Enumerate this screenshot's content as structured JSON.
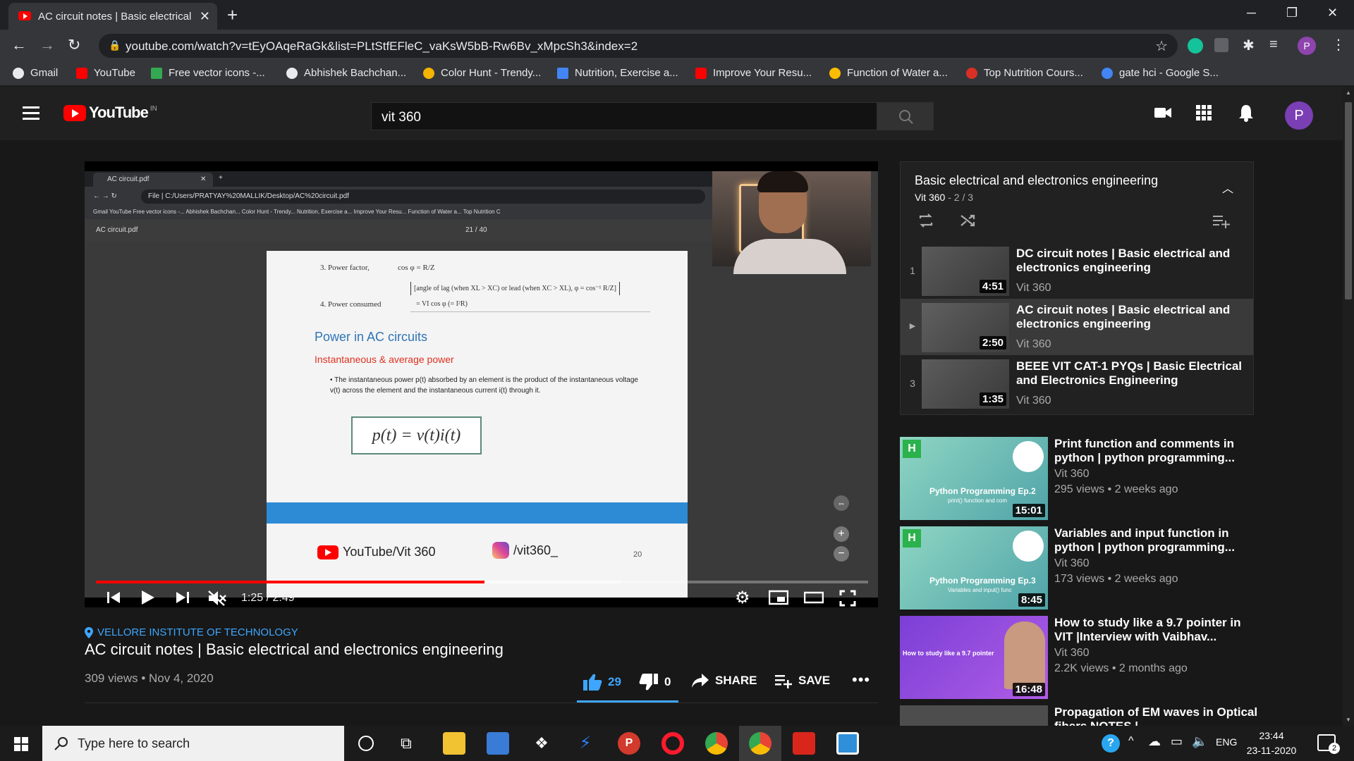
{
  "browser": {
    "tab_title": "AC circuit notes | Basic electrical",
    "new_tab": "+",
    "url": "youtube.com/watch?v=tEyOAqeRaGk&list=PLtStfEFleC_vaKsW5bB-Rw6Bv_xMpcSh3&index=2",
    "profile_initial": "P",
    "bookmarks": [
      {
        "label": "Gmail",
        "color": "#e8eaed"
      },
      {
        "label": "YouTube",
        "color": "#ff0000"
      },
      {
        "label": "Free vector icons -...",
        "color": "#34a853"
      },
      {
        "label": "Abhishek Bachchan...",
        "color": "#e8eaed"
      },
      {
        "label": "Color Hunt - Trendy...",
        "color": "#f4b400"
      },
      {
        "label": "Nutrition, Exercise a...",
        "color": "#4285f4"
      },
      {
        "label": "Improve Your Resu...",
        "color": "#ff0000"
      },
      {
        "label": "Function of Water a...",
        "color": "#fbbc04"
      },
      {
        "label": "Top Nutrition Cours...",
        "color": "#d93025"
      },
      {
        "label": "gate hci - Google S...",
        "color": "#4285f4"
      }
    ]
  },
  "youtube": {
    "logo_text": "YouTube",
    "region": "IN",
    "search_query": "vit 360",
    "avatar_initial": "P"
  },
  "player": {
    "time": "1:25 / 2:49",
    "progress_fraction": 0.503,
    "buffered_fraction": 0.48,
    "screen": {
      "tab": "AC circuit.pdf",
      "path": "File | C:/Users/PRATYAY%20MALLIK/Desktop/AC%20circuit.pdf",
      "bookmarks": "Gmail   YouTube   Free vector icons -...   Abhishek Bachchan...   Color Hunt - Trendy...   Nutrition, Exercise a...   Improve Your Resu...   Function of Water a...   Top Nutrition C",
      "pdf_name": "AC circuit.pdf",
      "page_count": "21 / 40",
      "line1": "3. Power factor,",
      "line1_formula": "cos φ = R/Z",
      "line2": "[angle of lag (when XL > XC) or lead (when XC > XL), φ = cos⁻¹ R/Z]",
      "line3": "4. Power consumed",
      "line3_formula": "= VI cos φ (= I²R)",
      "heading": "Power in AC circuits",
      "subheading": "Instantaneous & average power",
      "bullet": "The instantaneous power p(t) absorbed by an element is the product of the instantaneous voltage v(t) across the element and the instantaneous current i(t) through it.",
      "formula": "p(t) = v(t)i(t)",
      "footer_youtube": "YouTube/Vit 360",
      "footer_insta": "/vit360_",
      "page_number": "20"
    }
  },
  "video": {
    "location": "VELLORE INSTITUTE OF TECHNOLOGY",
    "title": "AC circuit notes | Basic electrical and electronics engineering",
    "views_date": "309 views • Nov 4, 2020",
    "likes": "29",
    "dislikes": "0",
    "share": "SHARE",
    "save": "SAVE"
  },
  "playlist": {
    "title": "Basic electrical and electronics engineering",
    "channel": "Vit 360",
    "position": " - 2 / 3",
    "items": [
      {
        "index": "1",
        "title": "DC circuit notes | Basic electrical and electronics engineering",
        "channel": "Vit 360",
        "duration": "4:51"
      },
      {
        "index": "▶",
        "title": "AC circuit notes | Basic electrical and electronics engineering",
        "channel": "Vit 360",
        "duration": "2:50"
      },
      {
        "index": "3",
        "title": "BEEE VIT CAT-1 PYQs | Basic Electrical and Electronics Engineering",
        "channel": "Vit 360",
        "duration": "1:35"
      }
    ]
  },
  "recommendations": [
    {
      "title": "Print function and comments in python | python programming...",
      "channel": "Vit 360",
      "meta": "295 views • 2 weeks ago",
      "duration": "15:01",
      "thumb_text": "Python Programming Ep.2",
      "thumb_sub": "print() function and com"
    },
    {
      "title": "Variables and input function in python | python programming...",
      "channel": "Vit 360",
      "meta": "173 views • 2 weeks ago",
      "duration": "8:45",
      "thumb_text": "Python Programming Ep.3",
      "thumb_sub": "Variables and input() func"
    },
    {
      "title": "How to study like a 9.7 pointer in VIT |Interview with Vaibhav...",
      "channel": "Vit 360",
      "meta": "2.2K views • 2 months ago",
      "duration": "16:48",
      "thumb_text": "How to study like a 9.7 pointer",
      "thumb_sub": ""
    },
    {
      "title": "Propagation of EM waves in Optical fibers NOTES |",
      "channel": "",
      "meta": "",
      "duration": "",
      "thumb_text": "",
      "thumb_sub": ""
    }
  ],
  "taskbar": {
    "search_placeholder": "Type here to search",
    "lang": "ENG",
    "time": "23:44",
    "date": "23-11-2020",
    "notifications": "2"
  }
}
